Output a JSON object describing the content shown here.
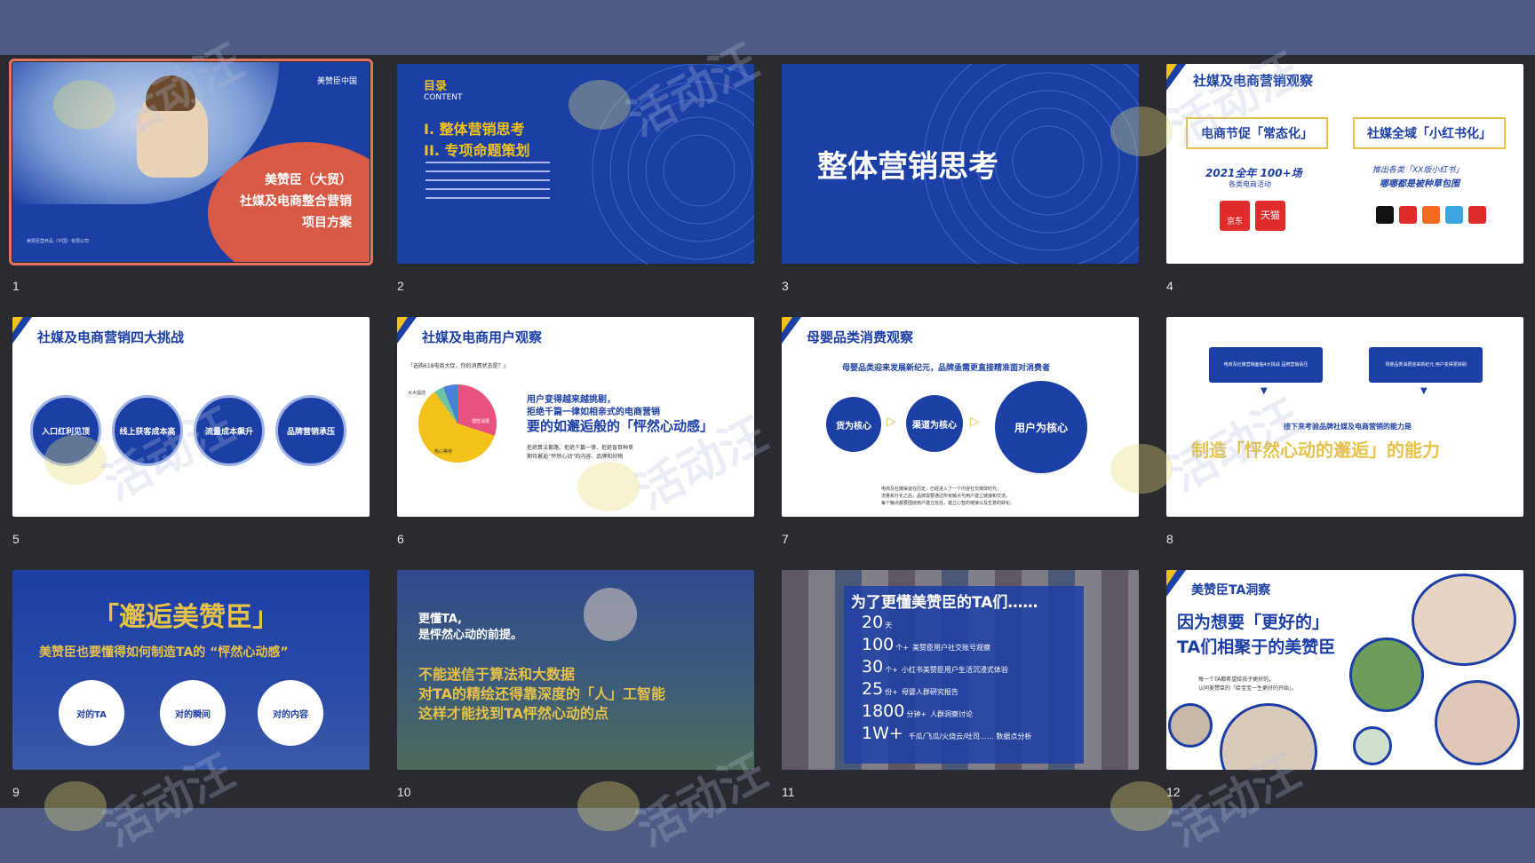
{
  "slides": [
    {
      "num": "1",
      "brand": "美赞臣中国",
      "title_lines": [
        "美赞臣（大贸）",
        "社媒及电商整合营销",
        "项目方案"
      ],
      "footer": "美赞臣营养品（中国）有限公司"
    },
    {
      "num": "2",
      "toc_title": "目录",
      "toc_sub": "CONTENT",
      "items": [
        "I.  整体营销思考",
        "II.  专项命题策划"
      ]
    },
    {
      "num": "3",
      "title": "整体营销思考"
    },
    {
      "num": "4",
      "title": "社媒及电商营销观察",
      "box1": "电商节促「常态化」",
      "box2": "社媒全域「小红书化」",
      "stat1": "2021全年 100+场",
      "stat1_sub": "各类电商活动",
      "stat2": "推出各类「XX版小红书」",
      "stat2_sub": "哪哪都是被种草包围",
      "logo1": "京东",
      "logo2": "天猫"
    },
    {
      "num": "5",
      "title": "社媒及电商营销四大挑战",
      "circles": [
        "入口红利见顶",
        "线上获客成本高",
        "流量成本飙升",
        "品牌营销承压"
      ]
    },
    {
      "num": "6",
      "title": "社媒及电商用户观察",
      "caption": "「选购618电商大促，你的消费状态是？」",
      "line1": "用户变得越来越挑剔，",
      "line2": "拒绝千篇一律如相亲式的电商营销",
      "headline": "要的如邂逅般的「怦然心动感」",
      "body1": "拒绝算法套路、拒绝千篇一律、拒绝盲目种草",
      "body2": "期待邂逅“怦然心动”的内容、品牌和好物",
      "pie_label1": "大大提前",
      "pie_label2": "理性消费",
      "pie_label3": "热心等待"
    },
    {
      "num": "7",
      "title": "母婴品类消费观察",
      "sub": "母婴品类迎来发展新纪元，品牌亟需更直接精准面对消费者",
      "c1": "货为核心",
      "c2": "渠道为核心",
      "c3": "用户为核心",
      "foot1": "电商及社媒渠道在历史，已经进入了一个内容社交媒体时代，",
      "foot2": "流量和分化之后，品牌需要通过所有触点与用户建立链接和交流，",
      "foot3": "每个触点都要围绕用户建立信任，建立心智的链接以及生意的转化。"
    },
    {
      "num": "8",
      "box1": "电商及社媒营销面临4大挑战 品牌营销承压",
      "box2": "母婴品类消费迎来新纪元 用户变得更挑剔",
      "mid": "接下来考验品牌社媒及电商营销的能力是",
      "big": "制造「怦然心动的邂逅」的能力"
    },
    {
      "num": "9",
      "title": "「邂逅美赞臣」",
      "sub": "美赞臣也要懂得如何制造TA的 “怦然心动感”",
      "c1": "对的TA",
      "c2": "对的瞬间",
      "c3": "对的内容"
    },
    {
      "num": "10",
      "l1": "更懂TA,",
      "l2": "是怦然心动的前提。",
      "l3": "不能迷信于算法和大数据",
      "l4": "对TA的精绘还得靠深度的「人」工智能",
      "l5": "这样才能找到TA怦然心动的点"
    },
    {
      "num": "11",
      "title": "为了更懂美赞臣的TA们……",
      "rows": [
        [
          "20",
          "天",
          ""
        ],
        [
          "100",
          "个+",
          "美赞臣用户社交账号观察"
        ],
        [
          "30",
          "个+",
          "小红书美赞臣用户生活沉浸式体验"
        ],
        [
          "25",
          "份+",
          "母婴人群研究报告"
        ],
        [
          "1800",
          "分钟+",
          "人群洞察讨论"
        ],
        [
          "1W+",
          "",
          "千瓜/飞瓜/火烧云/吐司…… 数据点分析"
        ]
      ]
    },
    {
      "num": "12",
      "title": "美赞臣TA洞察",
      "h1": "因为想要「更好的」",
      "h2": "TA们相聚于的美赞臣",
      "p1": "每一个TA都希望给孩子更好的，",
      "p2": "认同美赞臣的「给宝宝一生更好的开始」。"
    }
  ],
  "watermark": "活动汪",
  "colors": {
    "brand_blue": "#1c3fa6",
    "accent_red": "#e0533f",
    "gold": "#e6c24a",
    "selected": "#e8735c"
  }
}
